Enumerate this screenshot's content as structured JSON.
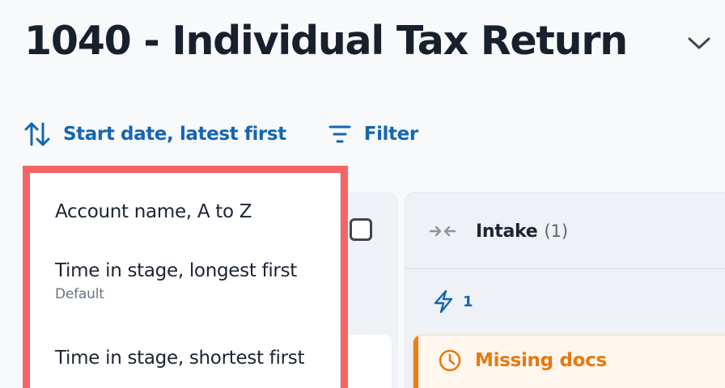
{
  "header": {
    "title": "1040 - Individual Tax Return"
  },
  "toolbar": {
    "sort_label": "Start date, latest first",
    "filter_label": "Filter"
  },
  "sort_menu": {
    "items": [
      {
        "label": "Account name, A to Z",
        "sublabel": ""
      },
      {
        "label": "Time in stage, longest first",
        "sublabel": "Default"
      },
      {
        "label": "Time in stage, shortest first",
        "sublabel": ""
      }
    ]
  },
  "board": {
    "columns": [
      {
        "title": "Intake",
        "count": "(1)",
        "automation_count": "1",
        "cards": [
          {
            "tag": "Missing docs"
          }
        ]
      }
    ]
  },
  "colors": {
    "accent_blue": "#1566b0",
    "highlight_red": "#f56565",
    "warning_orange": "#f07d12"
  },
  "icons": {
    "sort": "sort-arrows-icon",
    "filter": "filter-lines-icon",
    "chevron": "chevron-down-icon",
    "collapse": "collapse-arrows-icon",
    "automation": "lightning-icon",
    "clock": "clock-icon"
  }
}
